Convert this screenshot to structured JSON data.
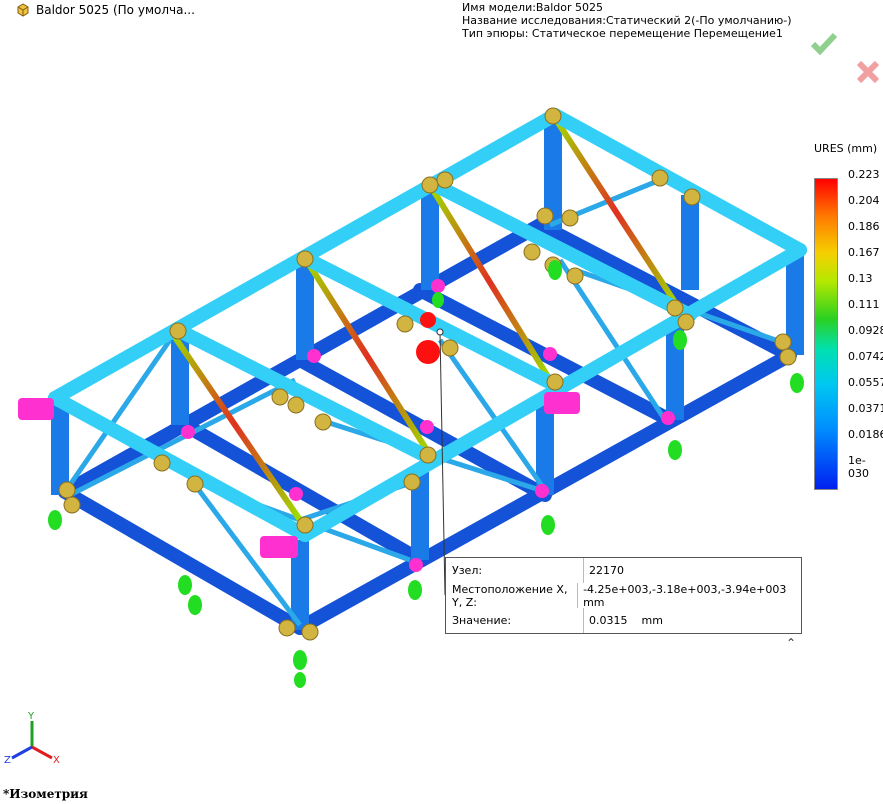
{
  "tree": {
    "title": "Baldor 5025  (По умолча..."
  },
  "study": {
    "model_name": "Имя модели:Baldor 5025",
    "study_name": "Название исследования:Статический 2(-По умолчанию-)",
    "plot_type": "Тип эпюры: Статическое перемещение Перемещение1"
  },
  "confirm": {
    "ok_icon": "check-icon",
    "cancel_icon": "close-icon"
  },
  "legend": {
    "title": "URES (mm)",
    "ticks": [
      "0.223",
      "0.204",
      "0.186",
      "0.167",
      "0.13",
      "0.111",
      "0.0928",
      "0.0742",
      "0.0557",
      "0.0371",
      "0.0186",
      "1e-030"
    ]
  },
  "probe": {
    "node_label": "Узел:",
    "node_value": "22170",
    "location_label": "Местоположение X, Y, Z:",
    "location_value": "-4.25e+003,-3.18e+003,-3.94e+003 mm",
    "value_label": "Значение:",
    "value_value": "0.0315",
    "value_unit": "mm"
  },
  "triad": {
    "y": "Y",
    "z": "Z",
    "x": "X"
  },
  "view": {
    "name": "*Изометрия"
  },
  "colors": {
    "frame": "#3ad8ff",
    "frame_dark": "#1060e0",
    "joint": "#d4b640",
    "load": "#ff30d0",
    "fixture": "#22dd22"
  }
}
